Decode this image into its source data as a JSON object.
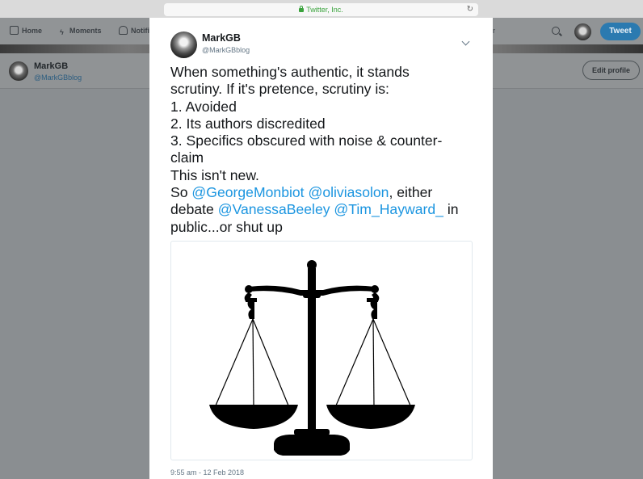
{
  "browser": {
    "url_text": "Twitter, Inc."
  },
  "nav": {
    "home_label": "Home",
    "moments_label": "Moments",
    "notifications_label": "Notifi",
    "search_partial": "r",
    "tweet_button_label": "Tweet"
  },
  "profile": {
    "name": "MarkGB",
    "handle": "@MarkGBblog",
    "edit_button_label": "Edit profile"
  },
  "tweet": {
    "author_name": "MarkGB",
    "author_handle": "@MarkGBblog",
    "lines": {
      "l1": "When something's authentic, it stands",
      "l2": "scrutiny. If it's pretence, scrutiny is:",
      "l3": "1. Avoided",
      "l4": "2. Its authors discredited",
      "l5": "3. Specifics obscured with noise & counter-",
      "l6": "claim",
      "l7": "This isn't new.",
      "l8_pre": "So ",
      "mention1": "@GeorgeMonbiot",
      "l8_mid": " ",
      "mention2": "@oliviasolon",
      "l8_post": ", either",
      "l9_pre": "debate ",
      "mention3": "@VanessaBeeley",
      "l9_mid": " ",
      "mention4": "@Tim_Hayward_",
      "l9_post": " in",
      "l10": "public...or shut up"
    },
    "timestamp": "9:55 am - 12 Feb 2018",
    "image_icon": "scales-of-justice-icon"
  },
  "colors": {
    "link": "#1b95e0",
    "tweet_button": "#2b7ab0",
    "secure_url": "#3aa33d"
  }
}
